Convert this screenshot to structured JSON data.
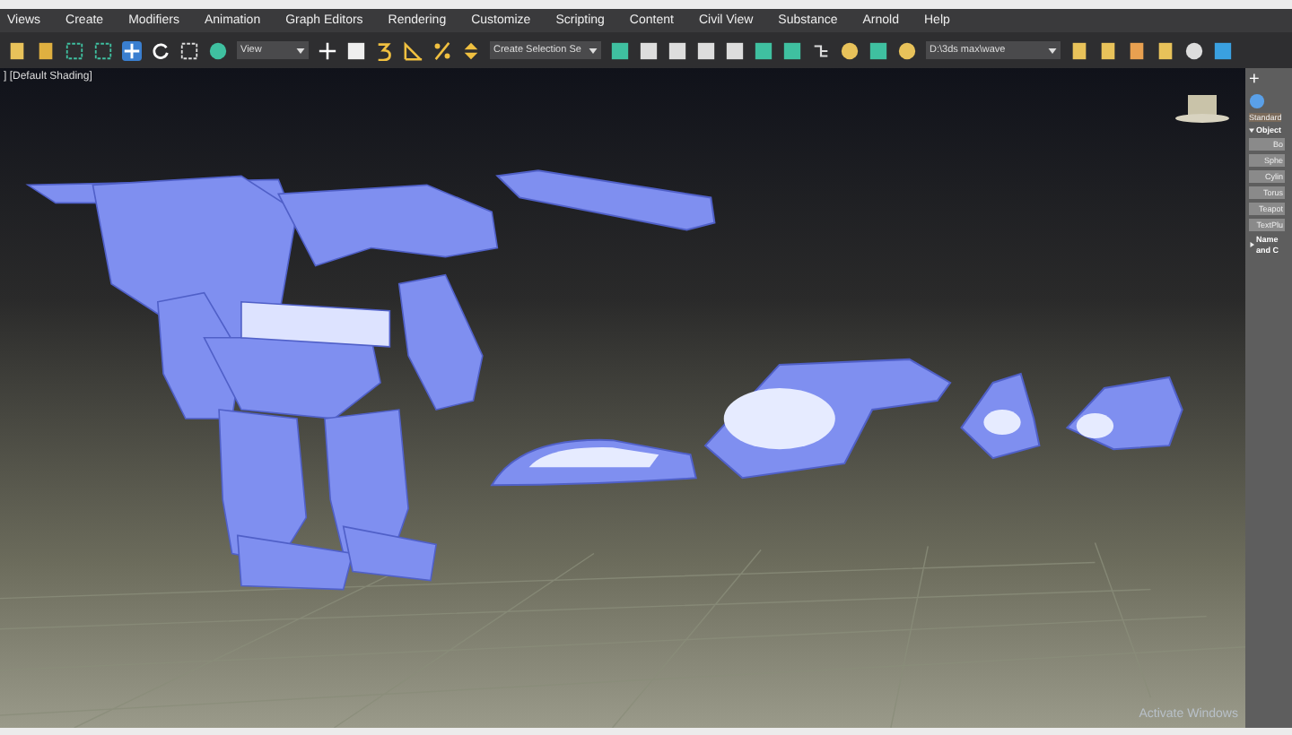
{
  "menu_bar": {
    "items": [
      "Views",
      "Create",
      "Modifiers",
      "Animation",
      "Graph Editors",
      "Rendering",
      "Customize",
      "Scripting",
      "Content",
      "Civil View",
      "Substance",
      "Arnold",
      "Help"
    ]
  },
  "toolbar": {
    "view_dropdown": "View",
    "selection_set_dropdown": "Create Selection Se",
    "project_path_dropdown": "D:\\3ds max\\wave"
  },
  "viewport": {
    "label": "] [Default Shading]",
    "activation_notice": "Activate Windows"
  },
  "command_panel": {
    "tab": "+",
    "category_dropdown": "Standard",
    "rollouts": [
      {
        "title": "Object",
        "expanded": true,
        "buttons": [
          "Bo",
          "Sphe",
          "Cylin",
          "Torus",
          "Teapot",
          "TextPlu"
        ]
      },
      {
        "title": "Name and C",
        "expanded": false
      }
    ]
  }
}
